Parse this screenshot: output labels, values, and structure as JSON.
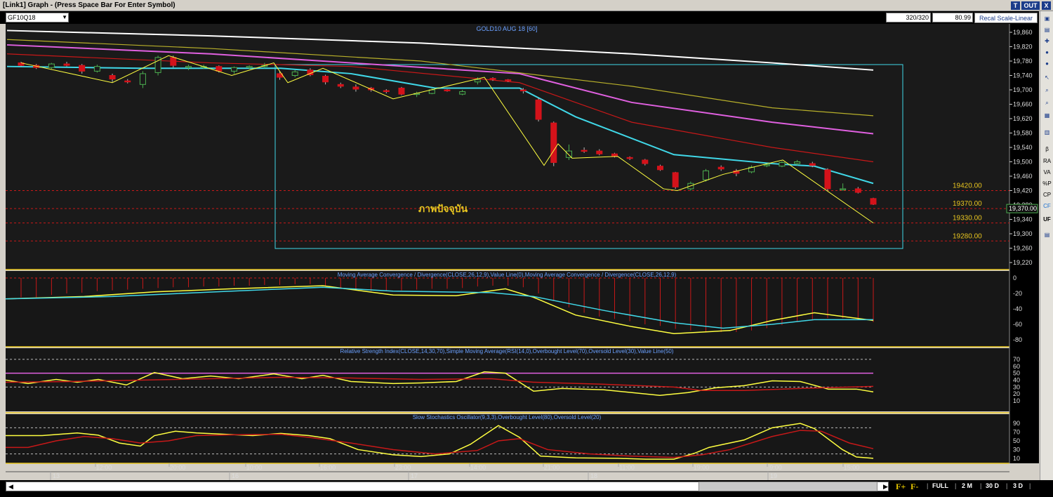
{
  "window": {
    "title": "[Link1] Graph - (Press Space Bar For Enter Symbol)",
    "btn_t": "T",
    "btn_out": "OUT",
    "btn_x": "X"
  },
  "toolbar": {
    "symbol": "GF10Q18",
    "bars": "320/320",
    "value": "80.99",
    "scale_label": "Recal Scale-Linear"
  },
  "sidebar": {
    "items": [
      "β",
      "RA",
      "VA",
      "%P",
      "CP",
      "CF",
      "UF"
    ]
  },
  "footer": {
    "f_plus": "F+",
    "f_minus": "F-",
    "full": "FULL",
    "m2": "2 M",
    "d30": "30 D",
    "d3": "3 D"
  },
  "colors": {
    "bg": "#000000",
    "panel": "#161616",
    "up": "#4caf50",
    "down": "#d4121a",
    "cyan": "#40d8e8",
    "magenta": "#e060e0",
    "yellow": "#ffff40",
    "white": "#ffffff",
    "olive": "#b8b02a",
    "red": "#c81818",
    "gold": "#e8c520"
  },
  "chart_data": {
    "type": "candlestick",
    "title": "GOLD10 AUG 18  [60]",
    "annotation": "ภาพปัจจุบัน",
    "ylim": [
      19200,
      19880
    ],
    "y_ticks": [
      "19,860",
      "19,820",
      "19,780",
      "19,740",
      "19,700",
      "19,660",
      "19,620",
      "19,580",
      "19,540",
      "19,500",
      "19,460",
      "19,420",
      "19,380",
      "19,340",
      "19,300",
      "19,260",
      "19,220"
    ],
    "last_price": "19,370.00",
    "levels": [
      {
        "label": "19420.00",
        "value": 19420
      },
      {
        "label": "19370.00",
        "value": 19370
      },
      {
        "label": "19330.00",
        "value": 19330
      },
      {
        "label": "19280.00",
        "value": 19280
      }
    ],
    "time_labels": [
      "12:00",
      "20:00",
      "10:00",
      "16:00",
      "23:00",
      "14:00",
      "21:00",
      "11:00",
      "19:00",
      "9:00",
      "15:00"
    ],
    "date_labels": [
      "13",
      "16",
      "17",
      "18",
      "19"
    ],
    "candles": [
      [
        19775,
        19778,
        19765,
        19768
      ],
      [
        19768,
        19772,
        19758,
        19762
      ],
      [
        19762,
        19775,
        19758,
        19772
      ],
      [
        19772,
        19778,
        19765,
        19768
      ],
      [
        19768,
        19772,
        19745,
        19752
      ],
      [
        19752,
        19770,
        19748,
        19765
      ],
      [
        19740,
        19745,
        19722,
        19730
      ],
      [
        19725,
        19730,
        19718,
        19722
      ],
      [
        19715,
        19752,
        19705,
        19745
      ],
      [
        19748,
        19795,
        19740,
        19790
      ],
      [
        19790,
        19795,
        19762,
        19768
      ],
      [
        19762,
        19770,
        19755,
        19765
      ],
      [
        19765,
        19770,
        19758,
        19765
      ],
      [
        19765,
        19768,
        19748,
        19752
      ],
      [
        19752,
        19765,
        19745,
        19762
      ],
      [
        19762,
        19768,
        19758,
        19765
      ],
      [
        19765,
        19775,
        19760,
        19768
      ],
      [
        19745,
        19752,
        19728,
        19735
      ],
      [
        19740,
        19755,
        19735,
        19750
      ],
      [
        19755,
        19760,
        19738,
        19742
      ],
      [
        19738,
        19742,
        19715,
        19722
      ],
      [
        19715,
        19720,
        19705,
        19710
      ],
      [
        19708,
        19715,
        19695,
        19702
      ],
      [
        19705,
        19708,
        19695,
        19700
      ],
      [
        19698,
        19702,
        19690,
        19697
      ],
      [
        19705,
        19708,
        19685,
        19688
      ],
      [
        19688,
        19695,
        19680,
        19690
      ],
      [
        19690,
        19705,
        19688,
        19700
      ],
      [
        19700,
        19702,
        19695,
        19698
      ],
      [
        19688,
        19700,
        19685,
        19695
      ],
      [
        19722,
        19735,
        19715,
        19728
      ],
      [
        19732,
        19735,
        19725,
        19730
      ],
      [
        19728,
        19730,
        19722,
        19725
      ],
      [
        19700,
        19705,
        19690,
        19698
      ],
      [
        19672,
        19678,
        19612,
        19618
      ],
      [
        19608,
        19612,
        19488,
        19498
      ],
      [
        19512,
        19548,
        19505,
        19530
      ],
      [
        19532,
        19540,
        19525,
        19530
      ],
      [
        19530,
        19535,
        19518,
        19522
      ],
      [
        19522,
        19525,
        19512,
        19515
      ],
      [
        19512,
        19515,
        19505,
        19510
      ],
      [
        19505,
        19508,
        19490,
        19495
      ],
      [
        19488,
        19492,
        19475,
        19478
      ],
      [
        19470,
        19472,
        19425,
        19430
      ],
      [
        19425,
        19445,
        19420,
        19440
      ],
      [
        19450,
        19480,
        19445,
        19475
      ],
      [
        19485,
        19490,
        19475,
        19480
      ],
      [
        19475,
        19480,
        19460,
        19468
      ],
      [
        19472,
        19490,
        19468,
        19485
      ],
      [
        19490,
        19495,
        19485,
        19492
      ],
      [
        19488,
        19502,
        19485,
        19498
      ],
      [
        19495,
        19505,
        19490,
        19500
      ],
      [
        19495,
        19500,
        19485,
        19490
      ],
      [
        19478,
        19482,
        19420,
        19425
      ],
      [
        19425,
        19440,
        19420,
        19425
      ],
      [
        19425,
        19430,
        19412,
        19415
      ],
      [
        19398,
        19400,
        19380,
        19382
      ]
    ],
    "macd_title": "Moving Average Convergence / Divergence(CLOSE,26,12,9),Value Line(0),Moving Average Convergence / Divergence(CLOSE,26,12,9)",
    "macd_ticks": [
      "0",
      "-20",
      "-40",
      "-60",
      "-80"
    ],
    "rsi_title": "Relative Strength Index(CLOSE,14,30,70),Simple Moving Average(RSI(14,0),Overbought Level(70),Oversold Level(30),Value Line(50)",
    "rsi_ticks": [
      "70",
      "60",
      "50",
      "40",
      "30",
      "20",
      "10"
    ],
    "stoch_title": "Slow Stochastics Oscillator(9,3,3),Overbought Level(80),Oversold Level(20)",
    "stoch_ticks": [
      "90",
      "70",
      "50",
      "30",
      "10"
    ]
  }
}
